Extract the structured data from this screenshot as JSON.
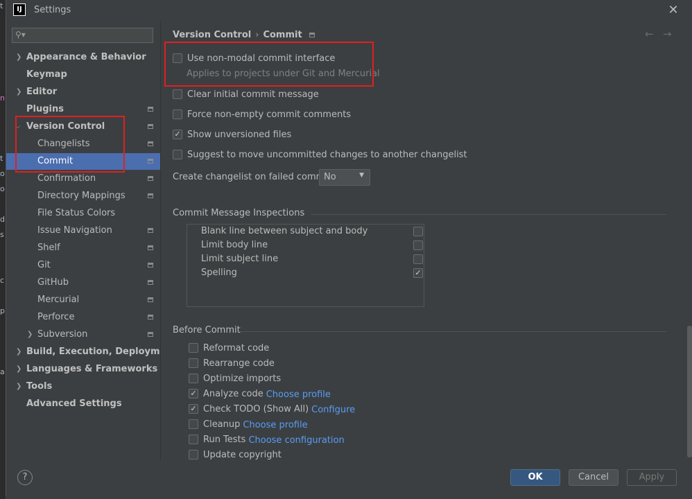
{
  "window": {
    "title": "Settings",
    "logo": "IJ"
  },
  "behind_text": [
    "t",
    "n",
    "t",
    "o",
    "o",
    "d",
    "s",
    "c",
    "p",
    "a"
  ],
  "search": {
    "placeholder": ""
  },
  "sidebar": {
    "items": [
      {
        "label": "Appearance & Behavior",
        "chevron": "right",
        "bold": true
      },
      {
        "label": "Keymap",
        "bold": true
      },
      {
        "label": "Editor",
        "chevron": "right",
        "bold": true
      },
      {
        "label": "Plugins",
        "bold": true,
        "project_icon": true
      },
      {
        "label": "Version Control",
        "chevron": "down",
        "bold": true,
        "project_icon": true
      },
      {
        "label": "Changelists",
        "project_icon": true
      },
      {
        "label": "Commit",
        "selected": true,
        "project_icon": true
      },
      {
        "label": "Confirmation",
        "project_icon": true
      },
      {
        "label": "Directory Mappings",
        "project_icon": true
      },
      {
        "label": "File Status Colors"
      },
      {
        "label": "Issue Navigation",
        "project_icon": true
      },
      {
        "label": "Shelf",
        "project_icon": true
      },
      {
        "label": "Git",
        "project_icon": true
      },
      {
        "label": "GitHub",
        "project_icon": true
      },
      {
        "label": "Mercurial",
        "project_icon": true
      },
      {
        "label": "Perforce",
        "project_icon": true
      },
      {
        "label": "Subversion",
        "chevron": "right",
        "project_icon": true
      },
      {
        "label": "Build, Execution, Deployment",
        "chevron": "right",
        "bold": true
      },
      {
        "label": "Languages & Frameworks",
        "chevron": "right",
        "bold": true
      },
      {
        "label": "Tools",
        "chevron": "right",
        "bold": true
      },
      {
        "label": "Advanced Settings",
        "bold": true
      }
    ]
  },
  "breadcrumb": {
    "parent": "Version Control",
    "current": "Commit"
  },
  "options": {
    "non_modal": {
      "label": "Use non-modal commit interface",
      "checked": false,
      "hint": "Applies to projects under Git and Mercurial"
    },
    "clear_initial": {
      "label": "Clear initial commit message",
      "checked": false
    },
    "force_nonempty": {
      "label": "Force non-empty commit comments",
      "checked": false
    },
    "show_unversioned": {
      "label": "Show unversioned files",
      "checked": true
    },
    "suggest_move": {
      "label": "Suggest to move uncommitted changes to another changelist",
      "checked": false
    }
  },
  "changelist_on_fail": {
    "label": "Create changelist on failed commit:",
    "value": "No"
  },
  "inspections": {
    "title": "Commit Message Inspections",
    "items": [
      {
        "label": "Blank line between subject and body",
        "checked": false
      },
      {
        "label": "Limit body line",
        "checked": false
      },
      {
        "label": "Limit subject line",
        "checked": false
      },
      {
        "label": "Spelling",
        "checked": true
      }
    ]
  },
  "before_commit": {
    "title": "Before Commit",
    "items": [
      {
        "label": "Reformat code",
        "checked": false,
        "link": ""
      },
      {
        "label": "Rearrange code",
        "checked": false,
        "link": ""
      },
      {
        "label": "Optimize imports",
        "checked": false,
        "link": ""
      },
      {
        "label": "Analyze code",
        "checked": true,
        "link": "Choose profile"
      },
      {
        "label": "Check TODO (Show All)",
        "checked": true,
        "link": "Configure"
      },
      {
        "label": "Cleanup",
        "checked": false,
        "link": "Choose profile"
      },
      {
        "label": "Run Tests",
        "checked": false,
        "link": "Choose configuration"
      },
      {
        "label": "Update copyright",
        "checked": false,
        "link": ""
      }
    ]
  },
  "buttons": {
    "ok": "OK",
    "cancel": "Cancel",
    "apply": "Apply",
    "help": "?"
  },
  "icons": {
    "close": "close-icon",
    "search": "search-icon",
    "back": "arrow-left-icon",
    "forward": "arrow-right-icon"
  },
  "colors": {
    "selection": "#4b6eaf",
    "link": "#589df6",
    "ok_button": "#365880",
    "highlight": "#e02020"
  }
}
